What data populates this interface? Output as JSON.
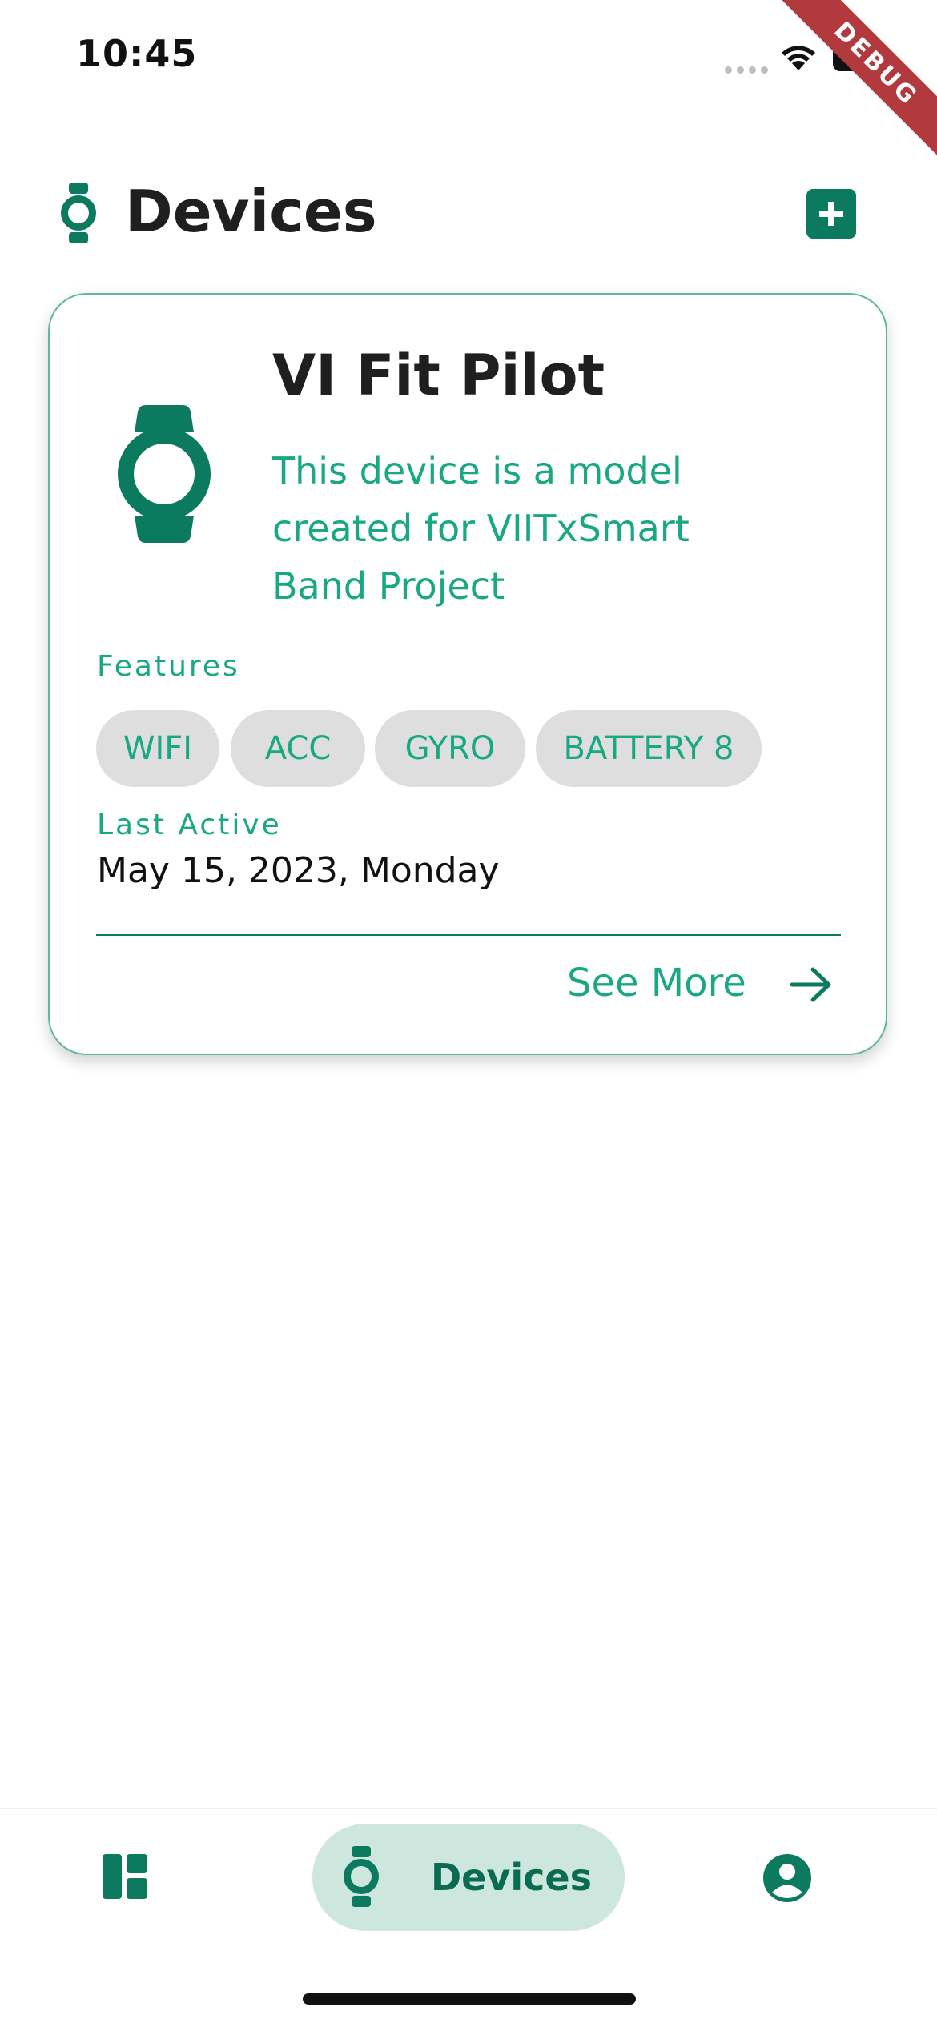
{
  "status_bar": {
    "time": "10:45",
    "debug_label": "DEBUG"
  },
  "header": {
    "title": "Devices",
    "icon": "watch-icon",
    "add_button_icon": "plus-icon"
  },
  "device_card": {
    "name": "VI Fit Pilot",
    "description": "This device is a model created for VIITxSmart Band Project",
    "features_label": "Features",
    "features": [
      "WIFI",
      "ACC",
      "GYRO",
      "BATTERY 8"
    ],
    "last_active_label": "Last Active",
    "last_active_value": "May 15, 2023, Monday",
    "see_more_label": "See More"
  },
  "bottom_nav": {
    "items": [
      {
        "icon": "dashboard-icon",
        "label": ""
      },
      {
        "icon": "watch-icon",
        "label": "Devices",
        "active": true
      },
      {
        "icon": "account-circle-icon",
        "label": ""
      }
    ]
  },
  "colors": {
    "primary": "#0b7a5f",
    "accent_text": "#18a884",
    "chip_bg": "#dedede",
    "nav_active_bg": "#cde7df",
    "debug_ribbon": "#b23a3e"
  }
}
